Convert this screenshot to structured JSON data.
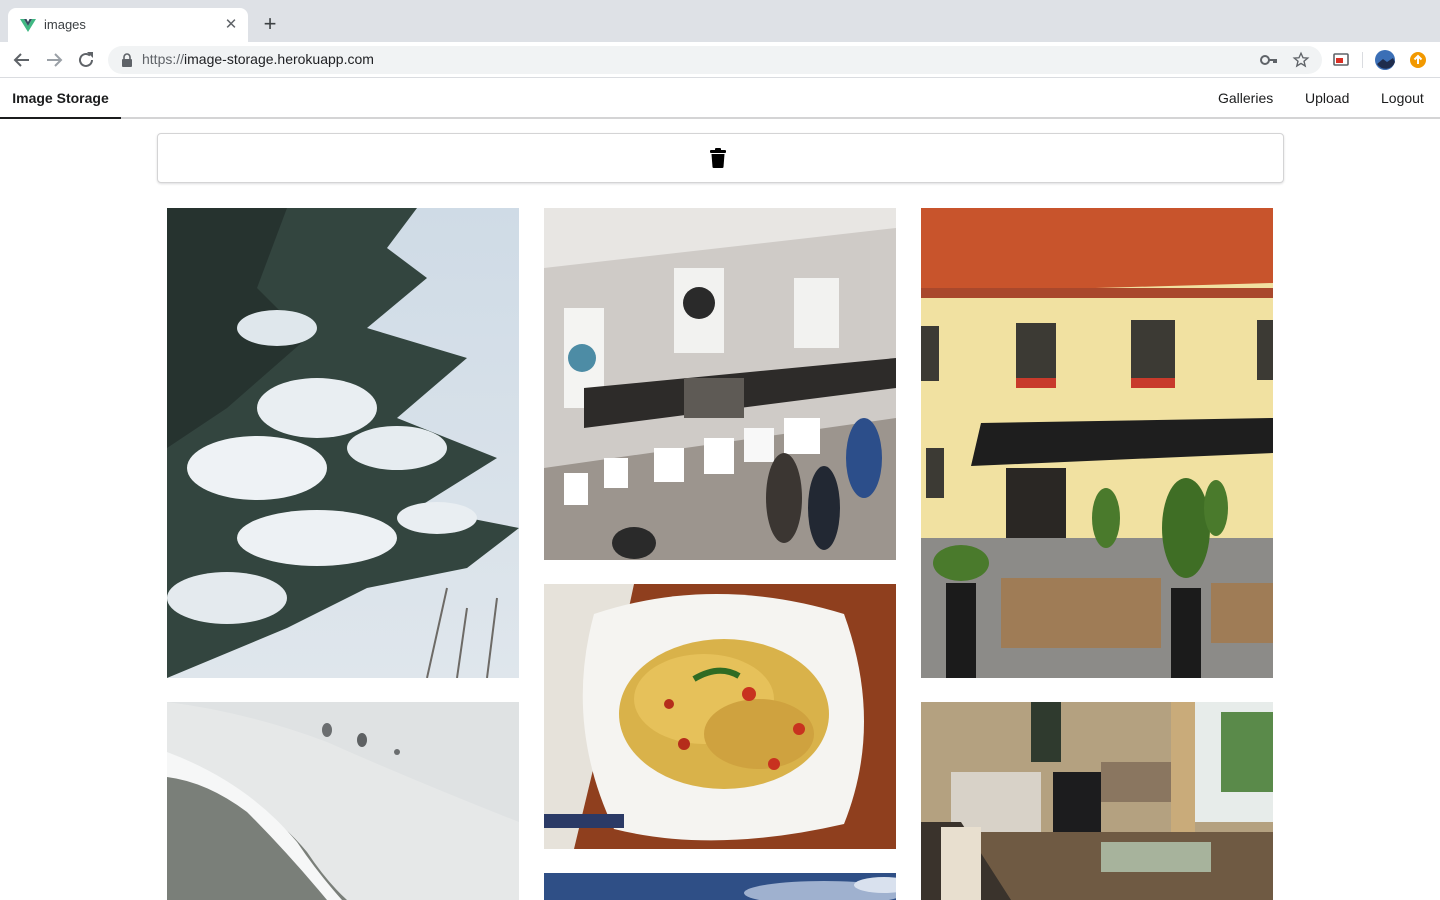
{
  "browser": {
    "tab_title": "images",
    "url_scheme": "https://",
    "url_host": "image-storage.herokuapp.com"
  },
  "app": {
    "brand": "Image Storage",
    "menu": [
      "Galleries",
      "Upload",
      "Logout"
    ]
  },
  "gallery": {
    "photos": [
      {
        "subject": "snowy pine branches"
      },
      {
        "subject": "cafe counter with shoppers"
      },
      {
        "subject": "yellow building with terrace cafe"
      },
      {
        "subject": "bowl of fusilli pasta"
      },
      {
        "subject": "icy shoreline with gulls"
      },
      {
        "subject": "sky"
      },
      {
        "subject": "living room interior"
      }
    ]
  },
  "colors": {
    "accent_dark": "#1b1c1d",
    "vue_green": "#41b883",
    "vue_dark": "#35495e",
    "profile_orange": "#f29900"
  }
}
